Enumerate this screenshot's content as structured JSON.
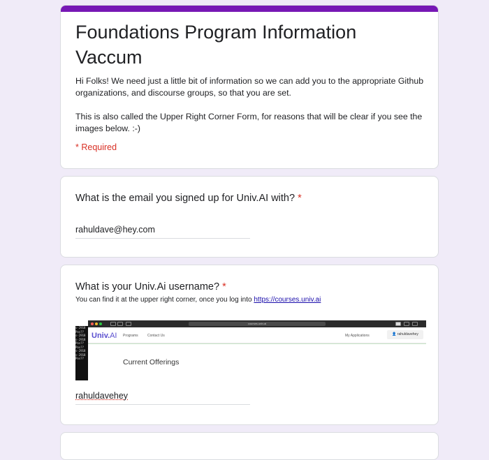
{
  "header": {
    "title": "Foundations Program Information Vaccum",
    "desc1": "Hi Folks! We need just a little bit of information so we can add you to the appropriate Github organizations, and discourse groups, so that you are set.",
    "desc2": "This is also called the Upper Right Corner Form, for reasons that will be clear if you see the images below. :-)",
    "required_note": "* Required",
    "accent": "#7718b5"
  },
  "q1": {
    "title": "What is the email you signed up for Univ.AI with?",
    "required": "*",
    "value": "rahuldave@hey.com"
  },
  "q2": {
    "title": "What is your Univ.Ai username?",
    "required": "*",
    "help": "You can find it at the upper right corner, once you log into",
    "help_link": "https://courses.univ.ai",
    "value": "rahuldavehey",
    "screenshot": {
      "url": "courses.univ.ai",
      "brand_bold": "Univ.",
      "brand_rest": "AI",
      "nav_programs": "Programs",
      "nav_contact": "Contact Us",
      "nav_apps": "My Applications",
      "username": "rahuldavehey",
      "heading": "Current Offerings",
      "terminal_lines": [
        "s-2918",
        "Pos??",
        "s-2918",
        "s-2918",
        "Pos??",
        "Pos??",
        "s-2918",
        "s-2918",
        "Pos??"
      ]
    }
  }
}
